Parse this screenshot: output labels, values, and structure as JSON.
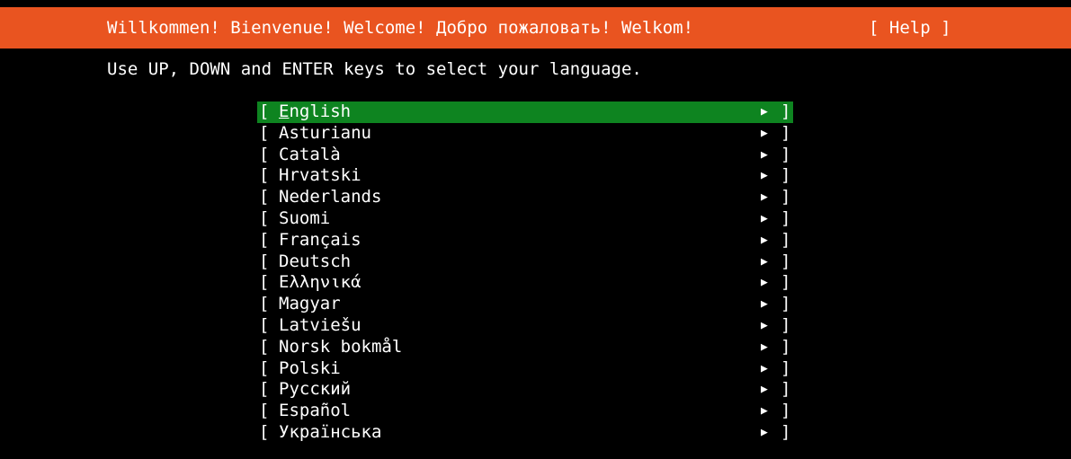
{
  "header": {
    "title": "Willkommen! Bienvenue! Welcome! Добро пожаловать! Welkom!",
    "help_label": "[ Help ]"
  },
  "instructions": "Use UP, DOWN and ENTER keys to select your language.",
  "list_glyphs": {
    "open_bracket": "[",
    "close_bracket": "]",
    "arrow": "▶"
  },
  "languages": [
    {
      "label": "English",
      "selected": true
    },
    {
      "label": "Asturianu"
    },
    {
      "label": "Català"
    },
    {
      "label": "Hrvatski"
    },
    {
      "label": "Nederlands"
    },
    {
      "label": "Suomi"
    },
    {
      "label": "Français"
    },
    {
      "label": "Deutsch"
    },
    {
      "label": "Ελληνικά"
    },
    {
      "label": "Magyar"
    },
    {
      "label": "Latviešu"
    },
    {
      "label": "Norsk bokmål"
    },
    {
      "label": "Polski"
    },
    {
      "label": "Русский"
    },
    {
      "label": "Español"
    },
    {
      "label": "Українська"
    }
  ],
  "colors": {
    "header_bg": "#e95420",
    "selected_bg": "#0e8420",
    "background": "#000000",
    "text": "#ffffff"
  }
}
